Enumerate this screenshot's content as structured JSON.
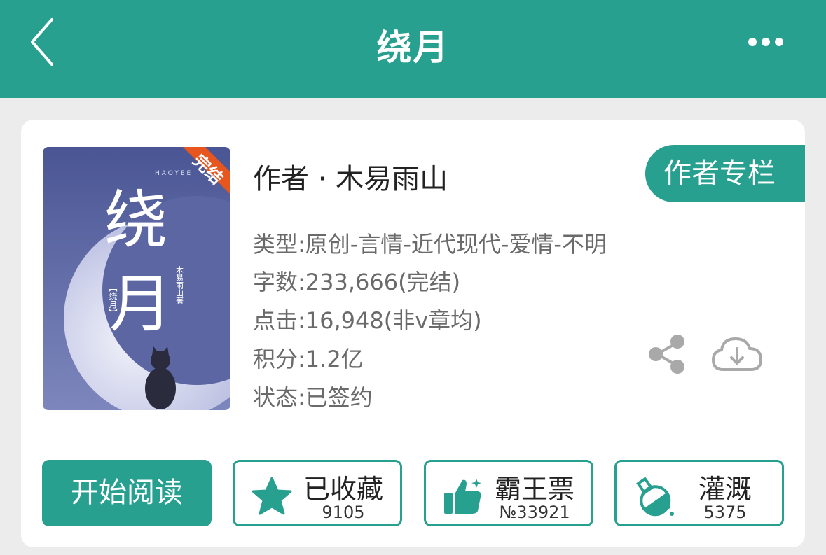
{
  "header": {
    "title": "绕月",
    "back_icon": "chevron-left-icon",
    "more_icon": "more-horizontal-icon"
  },
  "book": {
    "cover": {
      "badge": "完结",
      "title_text": "绕月",
      "top_text": "HAOYEE",
      "small_title": "【 绕 月 】",
      "author_text": "木易雨山 著"
    },
    "author_line": "作者 · 木易雨山",
    "author_column_button": "作者专栏",
    "type": "类型:原创-言情-近代现代-爱情-不明",
    "words": "字数:233,666(完结)",
    "clicks": "点击:16,948(非v章均)",
    "score": "积分:1.2亿",
    "status": "状态:已签约"
  },
  "icons": {
    "share": "share-icon",
    "download": "cloud-download-icon"
  },
  "actions": {
    "read": "开始阅读",
    "collect": {
      "label": "已收藏",
      "count": "9105",
      "icon": "star-icon"
    },
    "vote": {
      "label": "霸王票",
      "count": "№33921",
      "icon": "thumbs-up-icon"
    },
    "irrigate": {
      "label": "灌溉",
      "count": "5375",
      "icon": "flask-icon"
    }
  },
  "colors": {
    "accent": "#27a08f",
    "background": "#ececec",
    "icon_gray": "#a9a9a9"
  }
}
